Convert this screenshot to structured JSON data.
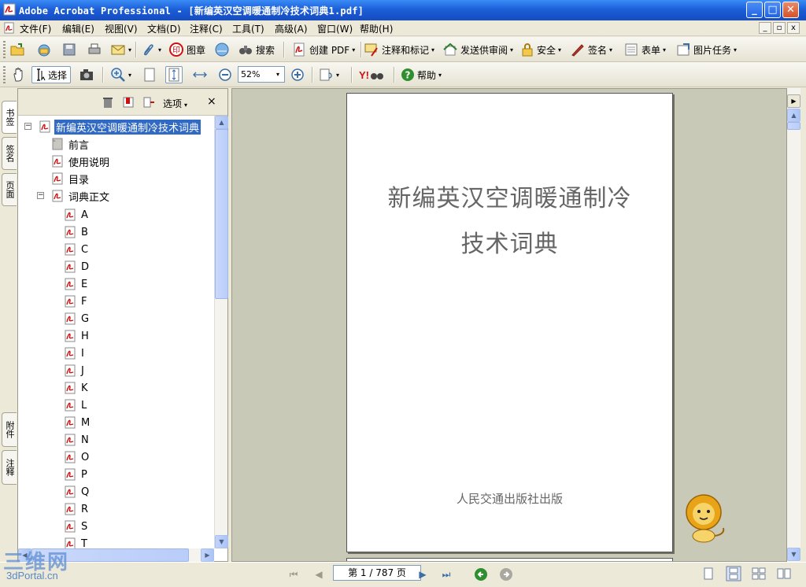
{
  "window": {
    "title": "Adobe Acrobat Professional - [新编英汉空调暖通制冷技术词典1.pdf]",
    "min_label": "_",
    "max_label": "□",
    "close_label": "✕"
  },
  "menu": {
    "items": [
      "文件(F)",
      "编辑(E)",
      "视图(V)",
      "文档(D)",
      "注释(C)",
      "工具(T)",
      "高级(A)",
      "窗口(W)",
      "帮助(H)"
    ],
    "doc_buttons": [
      "_",
      "▫",
      "x"
    ]
  },
  "toolbar1": {
    "stamp_label": "图章",
    "search_label": "搜索",
    "create_pdf_label": "创建 PDF",
    "comment_label": "注释和标记",
    "send_review_label": "发送供审阅",
    "security_label": "安全",
    "sign_label": "签名",
    "forms_label": "表单",
    "picture_tasks_label": "图片任务"
  },
  "toolbar2": {
    "select_label": "选择",
    "zoom_value": "52%",
    "help_label": "帮助",
    "yahoo_label": "Y!"
  },
  "side_tabs": {
    "bookmarks": "书签",
    "signatures": "签名",
    "pages": "页面",
    "attachments": "附件",
    "comments": "注释"
  },
  "nav_panel": {
    "options_label": "选项",
    "close_label": "×",
    "root": "新编英汉空调暖通制冷技术词典",
    "level1": [
      "前言",
      "使用说明",
      "目录",
      "词典正文"
    ],
    "letters": [
      "A",
      "B",
      "C",
      "D",
      "E",
      "F",
      "G",
      "H",
      "I",
      "J",
      "K",
      "L",
      "M",
      "N",
      "O",
      "P",
      "Q",
      "R",
      "S",
      "T"
    ]
  },
  "document": {
    "title_line1": "新编英汉空调暖通制冷",
    "title_line2": "技术词典",
    "publisher": "人民交通出版社出版"
  },
  "status": {
    "page_indicator": "第 1 / 787 页"
  },
  "watermark": {
    "line1": "三维网",
    "line2": "3dPortal.cn"
  }
}
